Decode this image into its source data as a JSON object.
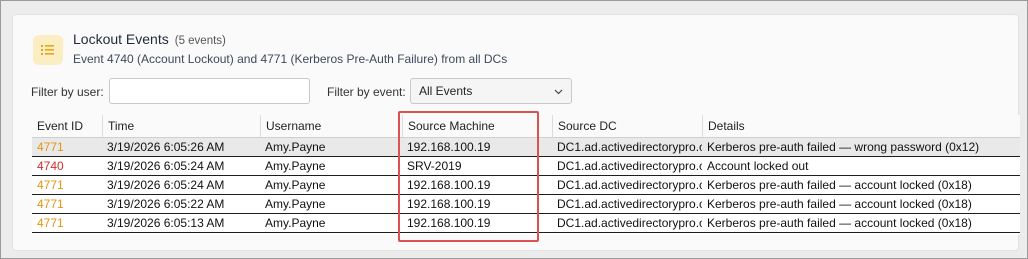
{
  "header": {
    "title": "Lockout Events",
    "count": "(5 events)",
    "subtitle": "Event 4740 (Account Lockout) and 4771 (Kerberos Pre-Auth Failure) from all DCs",
    "icon": "list-icon"
  },
  "filters": {
    "user_label": "Filter by user:",
    "user_value": "",
    "user_placeholder": "",
    "event_label": "Filter by event:",
    "event_selected": "All Events"
  },
  "table": {
    "columns": [
      "Event ID",
      "Time",
      "Username",
      "Source Machine",
      "Source DC",
      "Details"
    ],
    "rows": [
      {
        "event_id": "4771",
        "time": "3/19/2026 6:05:26 AM",
        "username": "Amy.Payne",
        "source_machine": "192.168.100.19",
        "source_dc": "DC1.ad.activedirectorypro.c",
        "details": "Kerberos pre-auth failed — wrong password (0x12)",
        "selected": true
      },
      {
        "event_id": "4740",
        "time": "3/19/2026 6:05:24 AM",
        "username": "Amy.Payne",
        "source_machine": "SRV-2019",
        "source_dc": "DC1.ad.activedirectorypro.c",
        "details": "Account locked out",
        "selected": false
      },
      {
        "event_id": "4771",
        "time": "3/19/2026 6:05:24 AM",
        "username": "Amy.Payne",
        "source_machine": "192.168.100.19",
        "source_dc": "DC1.ad.activedirectorypro.c",
        "details": "Kerberos pre-auth failed — account locked (0x18)",
        "selected": false
      },
      {
        "event_id": "4771",
        "time": "3/19/2026 6:05:22 AM",
        "username": "Amy.Payne",
        "source_machine": "192.168.100.19",
        "source_dc": "DC1.ad.activedirectorypro.c",
        "details": "Kerberos pre-auth failed — account locked (0x18)",
        "selected": false
      },
      {
        "event_id": "4771",
        "time": "3/19/2026 6:05:13 AM",
        "username": "Amy.Payne",
        "source_machine": "192.168.100.19",
        "source_dc": "DC1.ad.activedirectorypro.c",
        "details": "Kerberos pre-auth failed — account locked (0x18)",
        "selected": false
      }
    ]
  },
  "colors": {
    "event_4771": "#e69512",
    "event_4740": "#d42c2c",
    "highlight_box": "#d9534f",
    "icon_bg": "#fbeec3",
    "icon_fg": "#e5a618"
  }
}
